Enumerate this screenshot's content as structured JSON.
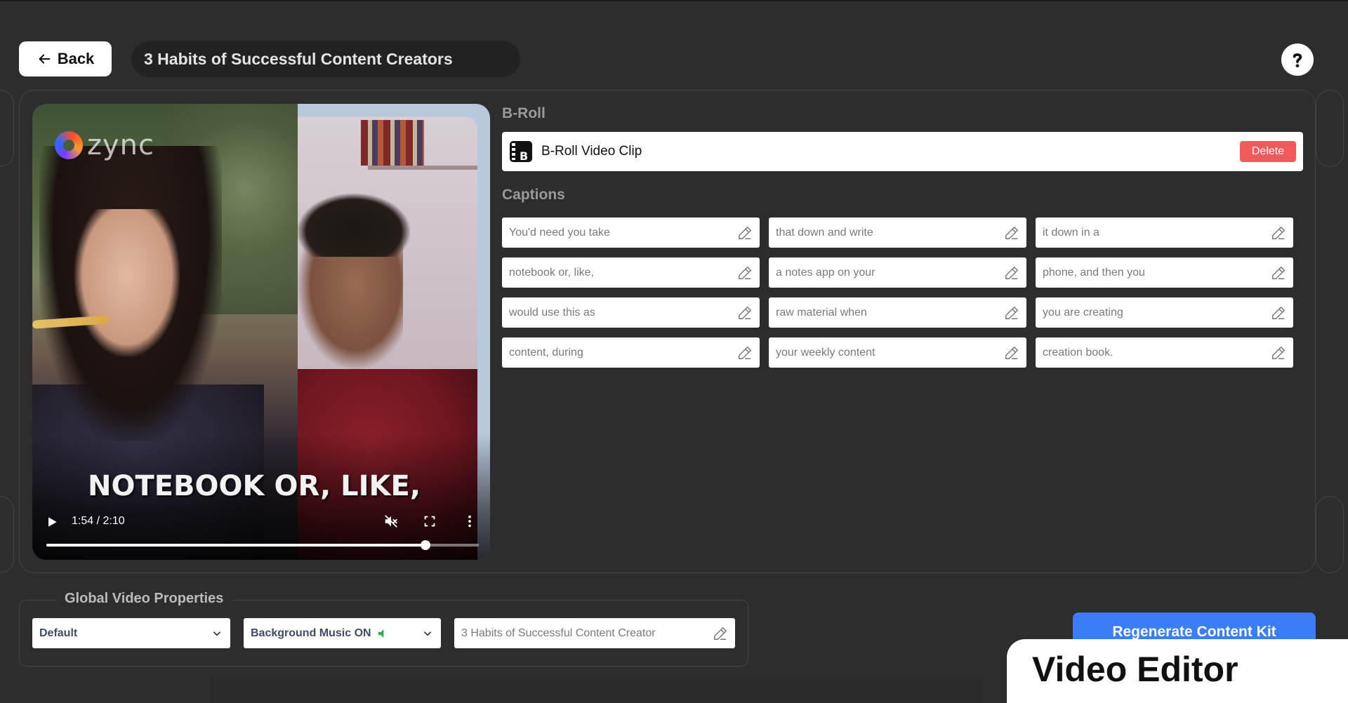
{
  "header": {
    "back_label": "Back",
    "project_title": "3 Habits of Successful Content Creators"
  },
  "video": {
    "logo_text": "zync",
    "caption_overlay": "NOTEBOOK OR, LIKE,",
    "time": "1:54 / 2:10",
    "progress_fraction": 0.877
  },
  "broll": {
    "section_label": "B-Roll",
    "clip_title": "B-Roll Video Clip",
    "delete_label": "Delete"
  },
  "captions": {
    "section_label": "Captions",
    "items": [
      "You'd need you take",
      "that down and write",
      "it down in a",
      "notebook or, like,",
      "a notes app on your",
      "phone, and then you",
      "would use this as",
      "raw material when",
      "you are creating",
      "content, during",
      "your weekly content",
      "creation book."
    ]
  },
  "global": {
    "title": "Global Video Properties",
    "style_select": "Default",
    "music_select": "Background Music ON",
    "video_title_value": "3 Habits of Successful Content Creator"
  },
  "actions": {
    "regenerate_label": "Regenerate Content Kit"
  },
  "overlay_card": {
    "label": "Video Editor"
  },
  "colors": {
    "background": "#2d2d2d",
    "delete": "#f15b5b",
    "primary": "#3b7df4",
    "music_on": "#2fa84f"
  }
}
